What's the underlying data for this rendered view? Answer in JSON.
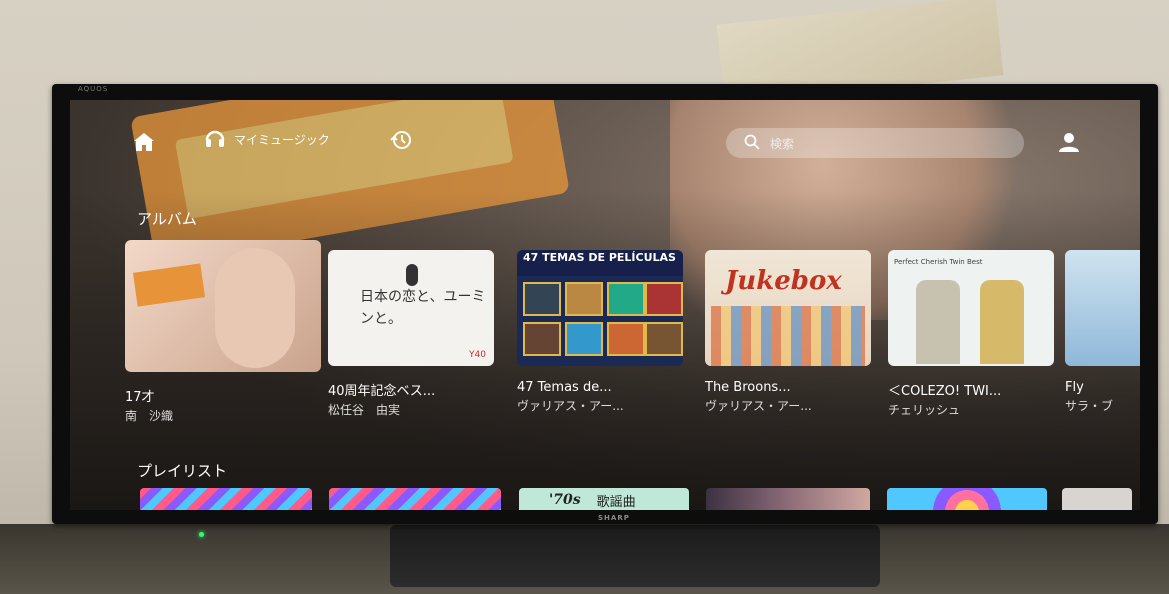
{
  "tv": {
    "brand": "AQUOS",
    "maker": "SHARP"
  },
  "nav": {
    "home_icon": "home-icon",
    "music_label": "マイミュージック",
    "music_icon": "headphones-icon",
    "recent_icon": "history-icon",
    "search_placeholder": "検索",
    "profile_icon": "profile-icon"
  },
  "albums": {
    "title": "アルバム",
    "items": [
      {
        "title": "17才",
        "artist": "南　沙織",
        "focused": true
      },
      {
        "title": "40周年記念ベス...",
        "artist": "松任谷　由実",
        "art_text": "日本の恋と、ユーミンと。",
        "art_badge": "Y40"
      },
      {
        "title": "47 Temas de...",
        "artist": "ヴァリアス・アー...",
        "art_text": "47 TEMAS DE PELÍCULAS"
      },
      {
        "title": "The Broons...",
        "artist": "ヴァリアス・アー...",
        "art_text": "Jukebox"
      },
      {
        "title": "＜COLEZO! TWI...",
        "artist": "チェリッシュ",
        "art_text": "Perfect Cherish Twin Best"
      },
      {
        "title": "Fly",
        "artist": "サラ・ブ"
      }
    ]
  },
  "playlists": {
    "title": "プレイリスト",
    "items": [
      {
        "style": "zig"
      },
      {
        "style": "zig"
      },
      {
        "style": "seventies",
        "label_big": "'70s",
        "label": "歌謡曲"
      },
      {
        "style": "photo"
      },
      {
        "style": "circle"
      },
      {
        "style": "mini"
      }
    ]
  }
}
